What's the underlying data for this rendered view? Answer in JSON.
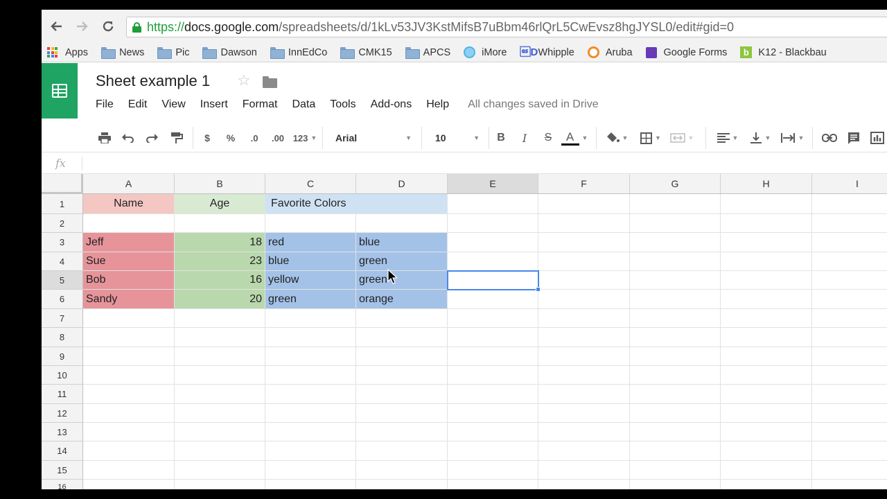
{
  "browser": {
    "back_icon": "arrow-left-icon",
    "forward_icon": "arrow-right-icon",
    "reload_icon": "reload-icon",
    "url_scheme": "https://",
    "url_host": "docs.google.com",
    "url_path": "/spreadsheets/d/1kLv53JV3KstMifsB7uBbm46rlQrL5CwEvsz8hgJYSL0/edit#gid=0",
    "bookmarks": [
      {
        "label": "Apps",
        "icon": "apps-grid-icon"
      },
      {
        "label": "News",
        "icon": "folder-icon"
      },
      {
        "label": "Pic",
        "icon": "folder-icon"
      },
      {
        "label": "Dawson",
        "icon": "folder-icon"
      },
      {
        "label": "InnEdCo",
        "icon": "folder-icon"
      },
      {
        "label": "CMK15",
        "icon": "folder-icon"
      },
      {
        "label": "APCS",
        "icon": "folder-icon"
      },
      {
        "label": "iMore",
        "icon": "imore-icon"
      },
      {
        "label": "Whipple",
        "icon": "whipple-icon"
      },
      {
        "label": "Aruba",
        "icon": "aruba-icon"
      },
      {
        "label": "Google Forms",
        "icon": "google-forms-icon"
      },
      {
        "label": "K12 - Blackbau",
        "icon": "blackbaud-icon"
      }
    ]
  },
  "sheets": {
    "title": "Sheet example 1",
    "save_status": "All changes saved in Drive",
    "menu": [
      "File",
      "Edit",
      "View",
      "Insert",
      "Format",
      "Data",
      "Tools",
      "Add-ons",
      "Help"
    ],
    "toolbar": {
      "currency": "$",
      "percent": "%",
      "decrease_decimals": ".0",
      "increase_decimals": ".00",
      "more_formats": "123",
      "font": "Arial",
      "font_size": "10",
      "bold": "B",
      "italic": "I",
      "strikethrough": "S",
      "text_color": "A"
    },
    "formula_bar": {
      "label": "fx",
      "value": ""
    }
  },
  "grid": {
    "columns": [
      "A",
      "B",
      "C",
      "D",
      "E",
      "F",
      "G",
      "H",
      "I"
    ],
    "rows": [
      "1",
      "2",
      "3",
      "4",
      "5",
      "6",
      "7",
      "8",
      "9",
      "10",
      "11",
      "12",
      "13",
      "14",
      "15",
      "16"
    ],
    "selected_cell": "E5",
    "header_row": [
      "Name",
      "Age",
      "Favorite Colors",
      ""
    ],
    "data_rows": [
      [
        "Jeff",
        "18",
        "red",
        "blue"
      ],
      [
        "Sue",
        "23",
        "blue",
        "green"
      ],
      [
        "Bob",
        "16",
        "yellow",
        "green"
      ],
      [
        "Sandy",
        "20",
        "green",
        "orange"
      ]
    ],
    "colors": {
      "name_header": "#f4c7c3",
      "age_header": "#d9ead3",
      "colors_header": "#cfe2f3",
      "name_data": "#e6949a",
      "age_data": "#b9d8ad",
      "colors_data": "#a4c2e8",
      "selection": "#4a86e8"
    }
  }
}
